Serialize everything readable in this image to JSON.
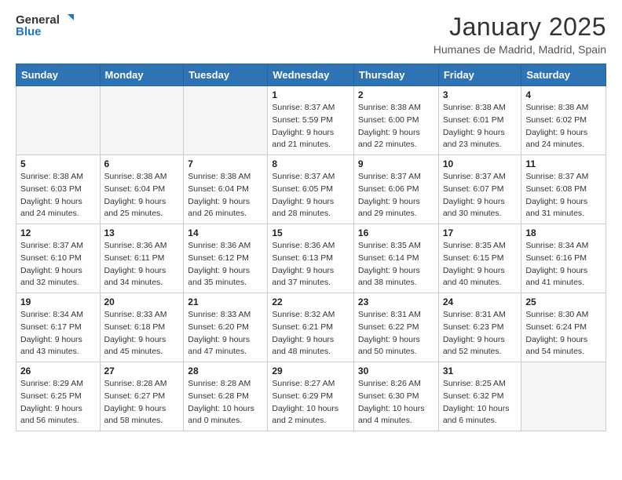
{
  "header": {
    "logo_general": "General",
    "logo_blue": "Blue",
    "month_title": "January 2025",
    "location": "Humanes de Madrid, Madrid, Spain"
  },
  "weekdays": [
    "Sunday",
    "Monday",
    "Tuesday",
    "Wednesday",
    "Thursday",
    "Friday",
    "Saturday"
  ],
  "weeks": [
    [
      {
        "day": "",
        "info": ""
      },
      {
        "day": "",
        "info": ""
      },
      {
        "day": "",
        "info": ""
      },
      {
        "day": "1",
        "info": "Sunrise: 8:37 AM\nSunset: 5:59 PM\nDaylight: 9 hours\nand 21 minutes."
      },
      {
        "day": "2",
        "info": "Sunrise: 8:38 AM\nSunset: 6:00 PM\nDaylight: 9 hours\nand 22 minutes."
      },
      {
        "day": "3",
        "info": "Sunrise: 8:38 AM\nSunset: 6:01 PM\nDaylight: 9 hours\nand 23 minutes."
      },
      {
        "day": "4",
        "info": "Sunrise: 8:38 AM\nSunset: 6:02 PM\nDaylight: 9 hours\nand 24 minutes."
      }
    ],
    [
      {
        "day": "5",
        "info": "Sunrise: 8:38 AM\nSunset: 6:03 PM\nDaylight: 9 hours\nand 24 minutes."
      },
      {
        "day": "6",
        "info": "Sunrise: 8:38 AM\nSunset: 6:04 PM\nDaylight: 9 hours\nand 25 minutes."
      },
      {
        "day": "7",
        "info": "Sunrise: 8:38 AM\nSunset: 6:04 PM\nDaylight: 9 hours\nand 26 minutes."
      },
      {
        "day": "8",
        "info": "Sunrise: 8:37 AM\nSunset: 6:05 PM\nDaylight: 9 hours\nand 28 minutes."
      },
      {
        "day": "9",
        "info": "Sunrise: 8:37 AM\nSunset: 6:06 PM\nDaylight: 9 hours\nand 29 minutes."
      },
      {
        "day": "10",
        "info": "Sunrise: 8:37 AM\nSunset: 6:07 PM\nDaylight: 9 hours\nand 30 minutes."
      },
      {
        "day": "11",
        "info": "Sunrise: 8:37 AM\nSunset: 6:08 PM\nDaylight: 9 hours\nand 31 minutes."
      }
    ],
    [
      {
        "day": "12",
        "info": "Sunrise: 8:37 AM\nSunset: 6:10 PM\nDaylight: 9 hours\nand 32 minutes."
      },
      {
        "day": "13",
        "info": "Sunrise: 8:36 AM\nSunset: 6:11 PM\nDaylight: 9 hours\nand 34 minutes."
      },
      {
        "day": "14",
        "info": "Sunrise: 8:36 AM\nSunset: 6:12 PM\nDaylight: 9 hours\nand 35 minutes."
      },
      {
        "day": "15",
        "info": "Sunrise: 8:36 AM\nSunset: 6:13 PM\nDaylight: 9 hours\nand 37 minutes."
      },
      {
        "day": "16",
        "info": "Sunrise: 8:35 AM\nSunset: 6:14 PM\nDaylight: 9 hours\nand 38 minutes."
      },
      {
        "day": "17",
        "info": "Sunrise: 8:35 AM\nSunset: 6:15 PM\nDaylight: 9 hours\nand 40 minutes."
      },
      {
        "day": "18",
        "info": "Sunrise: 8:34 AM\nSunset: 6:16 PM\nDaylight: 9 hours\nand 41 minutes."
      }
    ],
    [
      {
        "day": "19",
        "info": "Sunrise: 8:34 AM\nSunset: 6:17 PM\nDaylight: 9 hours\nand 43 minutes."
      },
      {
        "day": "20",
        "info": "Sunrise: 8:33 AM\nSunset: 6:18 PM\nDaylight: 9 hours\nand 45 minutes."
      },
      {
        "day": "21",
        "info": "Sunrise: 8:33 AM\nSunset: 6:20 PM\nDaylight: 9 hours\nand 47 minutes."
      },
      {
        "day": "22",
        "info": "Sunrise: 8:32 AM\nSunset: 6:21 PM\nDaylight: 9 hours\nand 48 minutes."
      },
      {
        "day": "23",
        "info": "Sunrise: 8:31 AM\nSunset: 6:22 PM\nDaylight: 9 hours\nand 50 minutes."
      },
      {
        "day": "24",
        "info": "Sunrise: 8:31 AM\nSunset: 6:23 PM\nDaylight: 9 hours\nand 52 minutes."
      },
      {
        "day": "25",
        "info": "Sunrise: 8:30 AM\nSunset: 6:24 PM\nDaylight: 9 hours\nand 54 minutes."
      }
    ],
    [
      {
        "day": "26",
        "info": "Sunrise: 8:29 AM\nSunset: 6:25 PM\nDaylight: 9 hours\nand 56 minutes."
      },
      {
        "day": "27",
        "info": "Sunrise: 8:28 AM\nSunset: 6:27 PM\nDaylight: 9 hours\nand 58 minutes."
      },
      {
        "day": "28",
        "info": "Sunrise: 8:28 AM\nSunset: 6:28 PM\nDaylight: 10 hours\nand 0 minutes."
      },
      {
        "day": "29",
        "info": "Sunrise: 8:27 AM\nSunset: 6:29 PM\nDaylight: 10 hours\nand 2 minutes."
      },
      {
        "day": "30",
        "info": "Sunrise: 8:26 AM\nSunset: 6:30 PM\nDaylight: 10 hours\nand 4 minutes."
      },
      {
        "day": "31",
        "info": "Sunrise: 8:25 AM\nSunset: 6:32 PM\nDaylight: 10 hours\nand 6 minutes."
      },
      {
        "day": "",
        "info": ""
      }
    ]
  ]
}
